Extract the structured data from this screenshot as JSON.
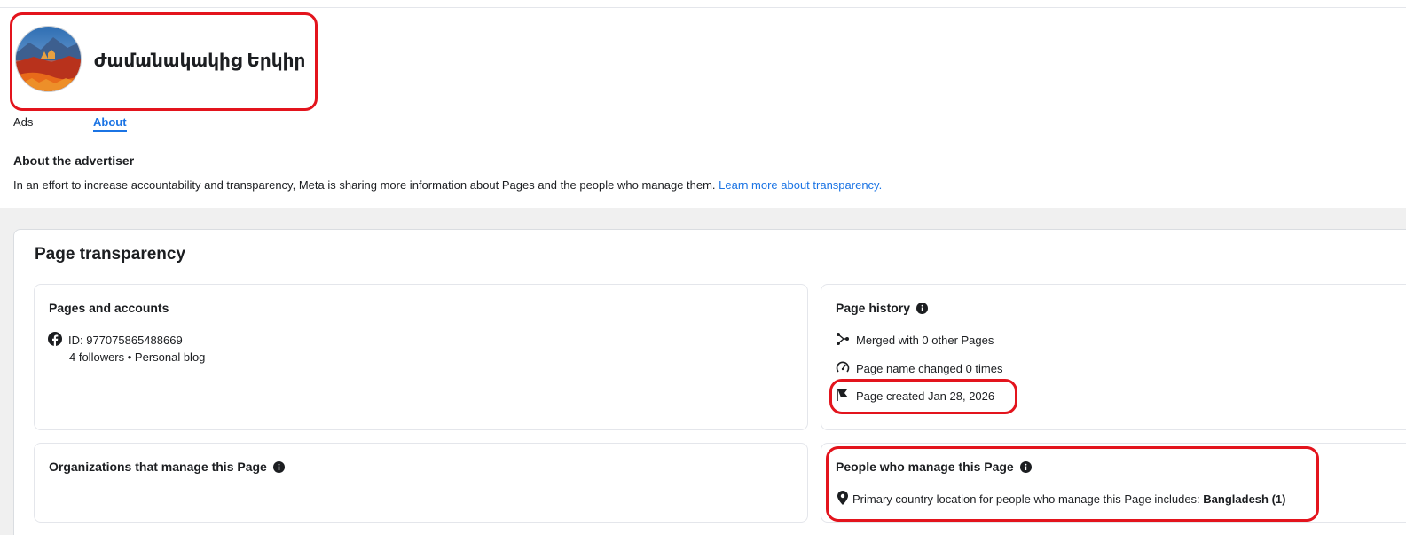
{
  "header": {
    "page_name": "Ժամանակակից Երկիր",
    "avatar_alt": "page-profile-picture"
  },
  "tabs": [
    {
      "label": "Ads",
      "active": false
    },
    {
      "label": "About",
      "active": true
    }
  ],
  "about_advertiser": {
    "title": "About the advertiser",
    "text": "In an effort to increase accountability and transparency, Meta is sharing more information about Pages and the people who manage them.",
    "link": "Learn more about transparency."
  },
  "transparency": {
    "title": "Page transparency",
    "pages_accounts": {
      "title": "Pages and accounts",
      "id_text": "ID: 977075865488669",
      "followers_text": "4 followers • Personal blog",
      "icon": "facebook-icon"
    },
    "page_history": {
      "title": "Page history",
      "items": [
        {
          "icon": "merge-icon",
          "text": "Merged with 0 other Pages"
        },
        {
          "icon": "edit-name-icon",
          "text": "Page name changed 0 times"
        },
        {
          "icon": "flag-icon",
          "text": "Page created Jan 28, 2026"
        }
      ]
    },
    "organizations": {
      "title": "Organizations that manage this Page"
    },
    "people": {
      "title": "People who manage this Page",
      "location_prefix": "Primary country location for people who manage this Page includes: ",
      "location_value": "Bangladesh (1)",
      "icon": "location-pin-icon"
    }
  },
  "colors": {
    "link": "#1b74e4",
    "highlight": "#e3141d",
    "background": "#f0f0f0"
  }
}
